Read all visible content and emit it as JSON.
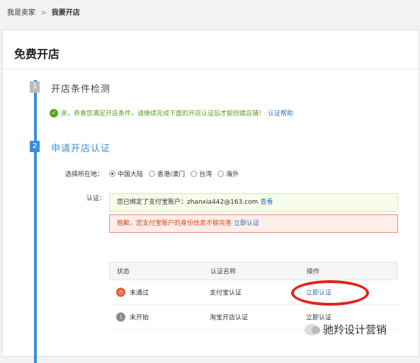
{
  "breadcrumb": {
    "home": "我是卖家",
    "separator": ">",
    "current": "我要开店"
  },
  "page_title": "免费开店",
  "steps": [
    {
      "number": "1",
      "label": "开店条件检测"
    },
    {
      "number": "2",
      "label": "申请开店认证"
    }
  ],
  "check_message": {
    "text": "亲，恭喜您满足开店条件，请继续完成下面的开店认证后才能创建店铺！",
    "help_link": "认证帮助"
  },
  "location": {
    "label": "选择所在地：",
    "options": [
      "中国大陆",
      "香港/澳门",
      "台湾",
      "海外"
    ],
    "selected": "中国大陆"
  },
  "auth": {
    "label": "认证：",
    "bound_text": "您已绑定了支付宝账户：zhanxia442@163.com",
    "bound_link": "查看",
    "warning_text": "抱歉，您支付宝账户的身份信息不够完善",
    "warning_link": "立即认证"
  },
  "table": {
    "headers": [
      "状态",
      "认证名称",
      "操作"
    ],
    "rows": [
      {
        "status": "未通过",
        "name": "支付宝认证",
        "action": "立即认证"
      },
      {
        "status": "未开始",
        "name": "淘宝开店认证",
        "action": "立即认证"
      }
    ]
  },
  "watermark": "驰羚设计营销",
  "colors": {
    "accent": "#3b8fd9",
    "success": "#5aa31f",
    "warning": "#d9401f",
    "highlight": "#e2231a"
  }
}
